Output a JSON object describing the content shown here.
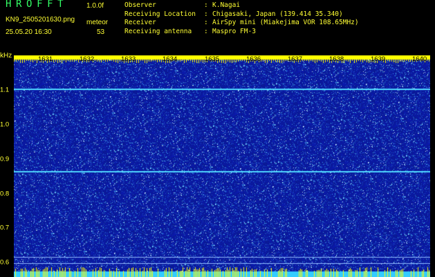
{
  "header": {
    "app_title": "HROFFT",
    "version": "1.0.0f",
    "filename": "KN9_2505201630.png",
    "datetime": "25.05.20 16:30",
    "meteor_label": "meteor",
    "meteor_count": "53"
  },
  "info": [
    {
      "key": "Observer",
      "value": "K.Nagai"
    },
    {
      "key": "Receiving Location",
      "value": "Chigasaki, Japan (139.414 35.340)"
    },
    {
      "key": "Receiver",
      "value": "AirSpy mini (Miakejima VOR 108.65MHz)"
    },
    {
      "key": "Receiving antenna",
      "value": "Maspro FM-3"
    }
  ],
  "y_axis": {
    "unit": "kHz",
    "ticks": [
      "1.1",
      "1.0",
      "0.9",
      "0.8",
      "0.7",
      "0.6"
    ]
  },
  "x_axis": {
    "ticks": [
      "1631",
      "1632",
      "1633",
      "1634",
      "1635",
      "1636",
      "1637",
      "1638",
      "1639",
      "1640"
    ]
  },
  "colors": {
    "background": "#000000",
    "label_text": "#ffff33",
    "title_text": "#33ff66",
    "waterfall_base": "#0d1f9c",
    "tick_band": "#ffff00",
    "signal_line": "#4fd8ff"
  }
}
